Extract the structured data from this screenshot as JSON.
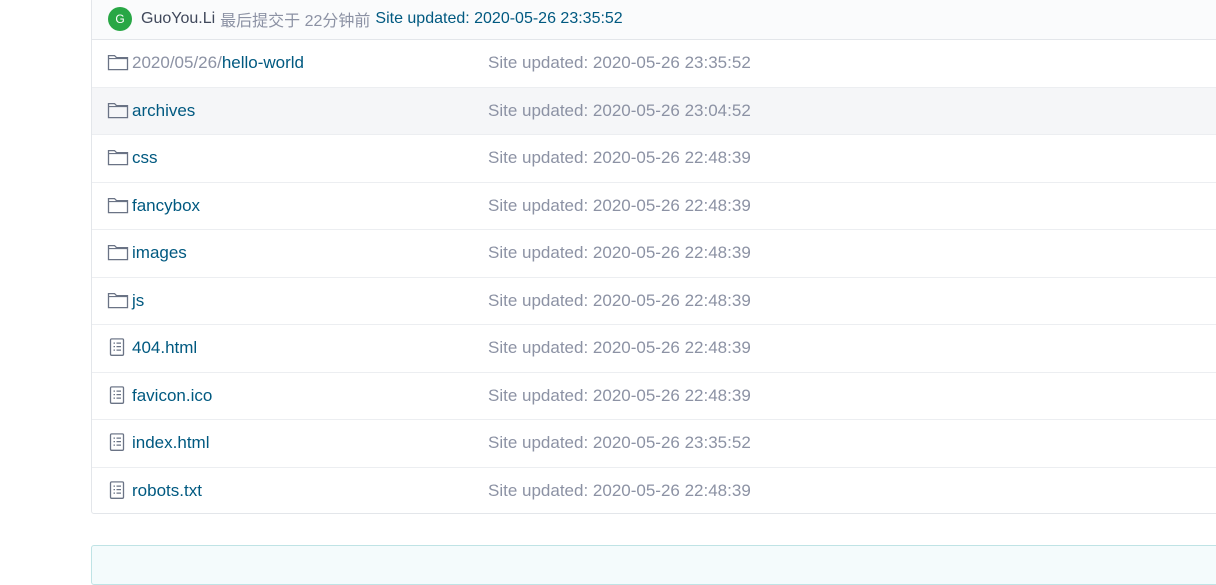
{
  "commit": {
    "avatar_letter": "G",
    "author": "GuoYou.Li",
    "meta": "最后提交于 22分钟前",
    "message": "Site updated: 2020-05-26 23:35:52",
    "avatar_color": "#28a745"
  },
  "files": [
    {
      "type": "folder",
      "icon": "folder-icon",
      "prefix": "2020/05/26/",
      "name": "hello-world",
      "message": "Site updated: 2020-05-26 23:35:52"
    },
    {
      "type": "folder",
      "icon": "folder-icon",
      "prefix": "",
      "name": "archives",
      "message": "Site updated: 2020-05-26 23:04:52"
    },
    {
      "type": "folder",
      "icon": "folder-icon",
      "prefix": "",
      "name": "css",
      "message": "Site updated: 2020-05-26 22:48:39"
    },
    {
      "type": "folder",
      "icon": "folder-icon",
      "prefix": "",
      "name": "fancybox",
      "message": "Site updated: 2020-05-26 22:48:39"
    },
    {
      "type": "folder",
      "icon": "folder-icon",
      "prefix": "",
      "name": "images",
      "message": "Site updated: 2020-05-26 22:48:39"
    },
    {
      "type": "folder",
      "icon": "folder-icon",
      "prefix": "",
      "name": "js",
      "message": "Site updated: 2020-05-26 22:48:39"
    },
    {
      "type": "file",
      "icon": "file-icon",
      "prefix": "",
      "name": "404.html",
      "message": "Site updated: 2020-05-26 22:48:39"
    },
    {
      "type": "file",
      "icon": "file-icon",
      "prefix": "",
      "name": "favicon.ico",
      "message": "Site updated: 2020-05-26 22:48:39"
    },
    {
      "type": "file",
      "icon": "file-icon",
      "prefix": "",
      "name": "index.html",
      "message": "Site updated: 2020-05-26 23:35:52"
    },
    {
      "type": "file",
      "icon": "file-icon",
      "prefix": "",
      "name": "robots.txt",
      "message": "Site updated: 2020-05-26 22:48:39"
    }
  ],
  "colors": {
    "link": "#005980",
    "muted": "#8c92a4",
    "hover_row": "#f5f6f8"
  }
}
